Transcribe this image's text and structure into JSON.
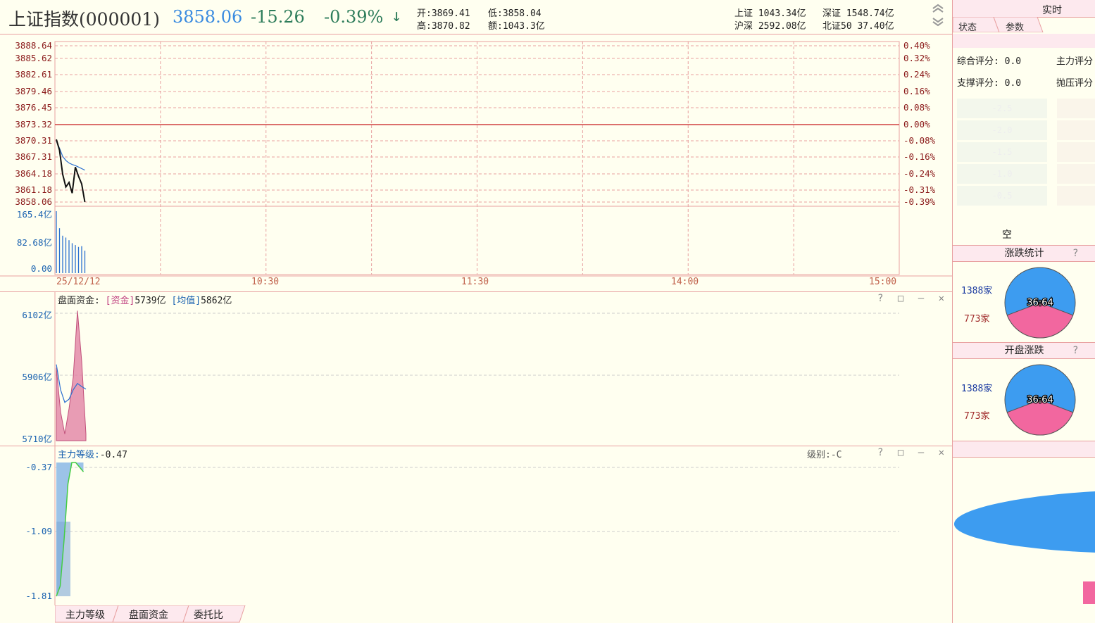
{
  "header": {
    "title": "上证指数(000001)",
    "price": "3858.06",
    "change": "-15.26",
    "pct": "-0.39%",
    "arrow": "↓",
    "open_label": "开:",
    "open": "3869.41",
    "low_label": "低:",
    "low": "3858.04",
    "high_label": "高:",
    "high": "3870.82",
    "amount_label": "额:",
    "amount": "1043.3亿",
    "sh_label": "上证",
    "sh_val": "1043.34亿",
    "sz_label": "深证",
    "sz_val": "1548.74亿",
    "hs_label": "沪深",
    "hs_val": "2592.08亿",
    "bz_label": "北证50",
    "bz_val": "37.40亿",
    "up_icon": "double-chevron-up-icon",
    "down_icon": "double-chevron-down-icon"
  },
  "price_chart": {
    "left_ticks": [
      "3888.64",
      "3885.62",
      "3882.61",
      "3879.46",
      "3876.45",
      "3873.32",
      "3870.31",
      "3867.31",
      "3864.18",
      "3861.18",
      "3858.06"
    ],
    "right_ticks": [
      "0.40%",
      "0.32%",
      "0.24%",
      "0.16%",
      "0.08%",
      "0.00%",
      "-0.08%",
      "-0.16%",
      "-0.24%",
      "-0.31%",
      "-0.39%"
    ],
    "volume_ticks": [
      "165.4亿",
      "82.68亿",
      "0.00"
    ],
    "time_labels": [
      "25/12/12",
      "10:30",
      "11:30",
      "14:00",
      "15:00"
    ],
    "prev_close": 3873.32,
    "price_series": [
      3870.31,
      3868.2,
      3863.5,
      3861.0,
      3861.9,
      3859.8,
      3864.9,
      3863.1,
      3861.6,
      3858.06
    ],
    "avg_series": [
      3870.0,
      3868.6,
      3867.0,
      3866.2,
      3865.7,
      3865.4,
      3865.2,
      3864.9,
      3864.6,
      3864.3
    ],
    "volume_series": [
      165.4,
      120,
      100,
      95,
      88,
      80,
      75,
      70,
      72,
      60
    ],
    "colors": {
      "grid": "#e8a0a0",
      "price": "#111111",
      "avg": "#2a6fd0",
      "volume": "#2a6fd0",
      "zero_line": "#d04040"
    }
  },
  "fund_panel": {
    "title": "盘面资金:",
    "fund_label": "[资金]",
    "fund_val": "5739亿",
    "avg_label": "[均值]",
    "avg_val": "5862亿",
    "ticks": [
      "6102亿",
      "5906亿",
      "5710亿"
    ],
    "fund_series": [
      5930,
      5790,
      5720,
      5800,
      5900,
      6110,
      5950,
      5720
    ],
    "avg_series": [
      5940,
      5860,
      5820,
      5830,
      5860,
      5880,
      5870,
      5862
    ],
    "colors": {
      "fund": "#e07ba0",
      "avg": "#2a6fd0"
    }
  },
  "main_panel": {
    "title": "主力等级:",
    "value": "-0.47",
    "level_label": "级别:-C",
    "ticks": [
      "-0.37",
      "-1.09",
      "-1.81"
    ],
    "series": [
      -1.81,
      -1.7,
      -1.2,
      -0.6,
      -0.37,
      -0.37,
      -0.42,
      -0.47
    ],
    "colors": {
      "area": "#9cc3e8",
      "line": "#44cc44"
    }
  },
  "panel_controls": {
    "help": "?",
    "restore": "□",
    "minimize": "—",
    "close": "✕"
  },
  "bottom_tabs": [
    "主力等级",
    "盘面资金",
    "委托比"
  ],
  "right": {
    "top_label": "实时",
    "tabs": [
      "状态",
      "参数"
    ],
    "score1_label": "综合评分:",
    "score1_val": "0.0",
    "score2_label": "主力评分",
    "score3_label": "支撑评分:",
    "score3_val": "0.0",
    "score4_label": "抛压评分",
    "bar_values": [
      "-2.5",
      "-2.0",
      "-1.5",
      "-1.0",
      "-0.5"
    ],
    "empty_label": "空",
    "updown_title": "涨跌统计",
    "updown_help": "?",
    "updown_up": "1388家",
    "updown_down": "773家",
    "updown_ratio": "36:64",
    "open_title": "开盘涨跌",
    "open_help": "?",
    "open_up": "1388家",
    "open_down": "773家",
    "open_ratio": "36:64",
    "pie_up_color": "#3d9cf0",
    "pie_down_color": "#f2679f"
  }
}
